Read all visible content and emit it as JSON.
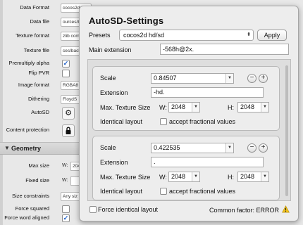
{
  "background_panel": {
    "rows": [
      {
        "label": "Data Format",
        "value": "cocos2d"
      },
      {
        "label": "Data file",
        "value": "ources/ba"
      },
      {
        "label": "Texture format",
        "value": "zlib com"
      },
      {
        "label": "Texture file",
        "value": "ces/back"
      },
      {
        "label": "Premultiply alpha",
        "checked": true
      },
      {
        "label": "Flip PVR",
        "checked": false
      },
      {
        "label": "Image format",
        "value": "RGBA8"
      },
      {
        "label": "Dithering",
        "value": "FloydS"
      },
      {
        "label": "AutoSD",
        "icon": "gear-icon"
      },
      {
        "label": "Content protection",
        "icon": "lock-icon"
      }
    ],
    "section_title": "Geometry",
    "geometry_rows": [
      {
        "label": "Max size",
        "prefix": "W:",
        "value": "204"
      },
      {
        "label": "Fixed size",
        "prefix": "W:",
        "value": ""
      },
      {
        "label": "Size constraints",
        "value": "Any siz"
      },
      {
        "label": "Force squared",
        "checked": false
      },
      {
        "label": "Force word aligned",
        "checked": true
      }
    ]
  },
  "popover": {
    "title": "AutoSD-Settings",
    "presets_label": "Presets",
    "presets_value": "cocos2d hd/sd",
    "apply_label": "Apply",
    "main_extension_label": "Main extension",
    "main_extension_value": "-568h@2x.",
    "variants": [
      {
        "scale_label": "Scale",
        "scale_value": "0.84507",
        "extension_label": "Extension",
        "extension_value": "-hd.",
        "max_label": "Max. Texture Size",
        "w_label": "W:",
        "w_value": "2048",
        "h_label": "H:",
        "h_value": "2048",
        "identical_label": "Identical layout",
        "fractional_label": "accept fractional values",
        "remove_label": "−",
        "add_label": "+"
      },
      {
        "scale_label": "Scale",
        "scale_value": "0.422535",
        "extension_label": "Extension",
        "extension_value": ".",
        "max_label": "Max. Texture Size",
        "w_label": "W:",
        "w_value": "2048",
        "h_label": "H:",
        "h_value": "2048",
        "identical_label": "Identical layout",
        "fractional_label": "accept fractional values",
        "remove_label": "−",
        "add_label": "+"
      }
    ],
    "force_identical_label": "Force identical layout",
    "common_factor_text": "Common factor: ERROR"
  },
  "colors": {
    "checkmark": "#1c5ec7",
    "warning": "#f2c21b"
  }
}
